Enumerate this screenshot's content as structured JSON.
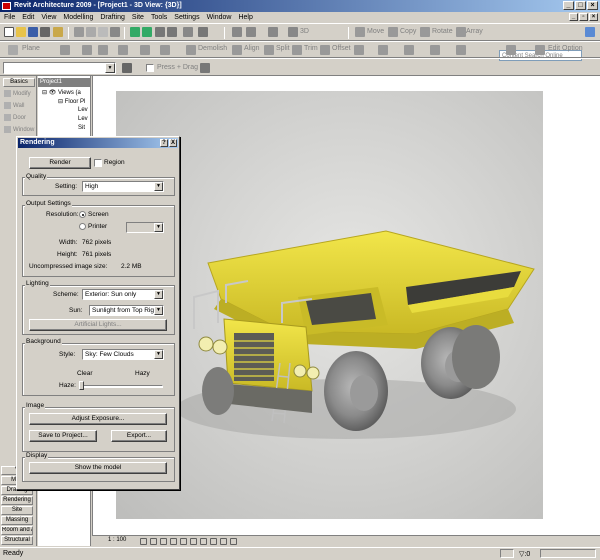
{
  "window": {
    "title": "Revit Architecture 2009 - [Project1 - 3D View: {3D}]"
  },
  "menu": [
    "File",
    "Edit",
    "View",
    "Modelling",
    "Drafting",
    "Site",
    "Tools",
    "Settings",
    "Window",
    "Help"
  ],
  "toolbar": {
    "search_placeholder": "Content Search Online",
    "modify_tools": [
      "Move",
      "Copy",
      "Rotate",
      "Array"
    ],
    "view_3d": "3D",
    "tb2_left": "Plane",
    "demolish": "Demolish",
    "edit_tools": [
      "Align",
      "Split",
      "Trim",
      "Offset"
    ],
    "edit_option": "Edit Option",
    "press_drag": "Press + Drag"
  },
  "design_bar": {
    "tab": "Basics",
    "items": [
      "Modify",
      "Wall",
      "Door",
      "Window"
    ],
    "bottom_tabs": [
      "V",
      "Mod",
      "Drafting",
      "Rendering",
      "Site",
      "Massing",
      "Room and Area",
      "Structural"
    ]
  },
  "project_browser": {
    "title": "Project1",
    "tree": [
      "Views (a",
      "Floor Pl",
      "Lev",
      "Lev",
      "Sit"
    ]
  },
  "dialog": {
    "title": "Rendering",
    "help": "?",
    "close": "X",
    "render_button": "Render",
    "region_label": "Region",
    "quality": {
      "group": "Quality",
      "setting_label": "Setting:",
      "setting_value": "High"
    },
    "output": {
      "group": "Output Settings",
      "resolution_label": "Resolution:",
      "screen": "Screen",
      "printer": "Printer",
      "width_label": "Width:",
      "width_value": "762 pixels",
      "height_label": "Height:",
      "height_value": "761 pixels",
      "uncompressed_label": "Uncompressed image size:",
      "uncompressed_value": "2.2 MB"
    },
    "lighting": {
      "group": "Lighting",
      "scheme_label": "Scheme:",
      "scheme_value": "Exterior: Sun only",
      "sun_label": "Sun:",
      "sun_value": "Sunlight from Top Right",
      "artificial_button": "Artificial Lights..."
    },
    "background": {
      "group": "Background",
      "style_label": "Style:",
      "style_value": "Sky: Few Clouds",
      "clear": "Clear",
      "hazy": "Hazy",
      "haze_label": "Haze:",
      "haze_level": 0
    },
    "image": {
      "group": "Image",
      "adjust_button": "Adjust Exposure...",
      "save_button": "Save to Project...",
      "export_button": "Export..."
    },
    "display": {
      "group": "Display",
      "show_button": "Show the model"
    }
  },
  "view_control": {
    "scale": "1 : 100"
  },
  "status": {
    "text": "Ready",
    "filter_count": "0"
  },
  "colors": {
    "title_start": "#0a246a",
    "title_end": "#a6caf0",
    "truck_yellow": "#e8d833",
    "chrome": "#d4d0c8"
  }
}
